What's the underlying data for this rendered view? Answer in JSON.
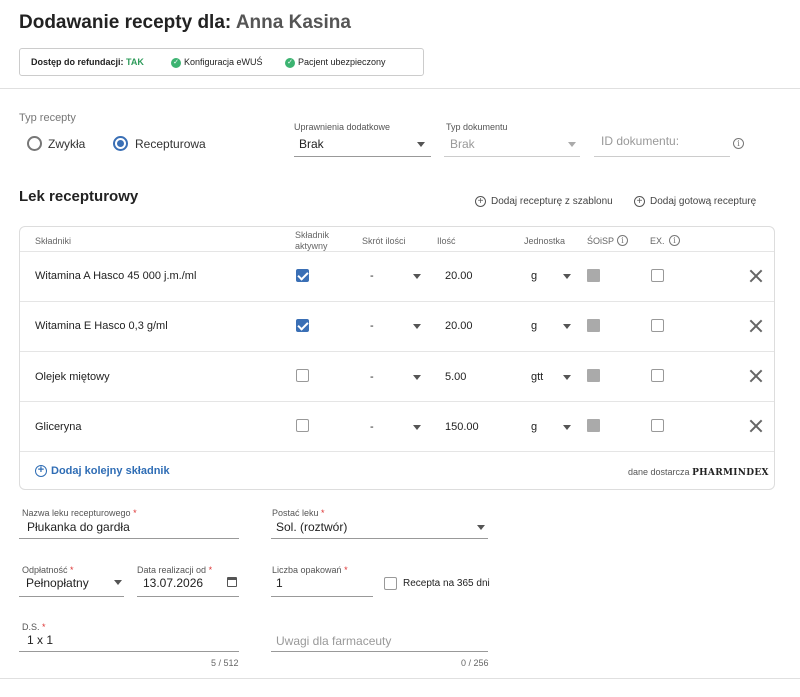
{
  "header": {
    "title_prefix": "Dodawanie recepty dla:",
    "patient_name": "Anna Kasina"
  },
  "status": {
    "refund_label": "Dostęp do refundacji:",
    "refund_value": "TAK",
    "ewus_label": "Konfiguracja eWUŚ",
    "insured_label": "Pacjent ubezpieczony"
  },
  "prescription_type": {
    "label": "Typ recepty",
    "options": [
      "Zwykła",
      "Recepturowa"
    ],
    "selected": "Recepturowa"
  },
  "permissions": {
    "label": "Uprawnienia dodatkowe",
    "value": "Brak"
  },
  "document_type": {
    "label": "Typ dokumentu",
    "value": "Brak"
  },
  "document_id": {
    "placeholder": "ID dokumentu:"
  },
  "section": {
    "title": "Lek recepturowy",
    "template_action": "Dodaj recepturę z szablonu",
    "ready_action": "Dodaj gotową recepturę"
  },
  "table": {
    "headers": {
      "ingredients": "Składniki",
      "active_line1": "Składnik",
      "active_line2": "aktywny",
      "abbrev": "Skrót ilości",
      "amount": "Ilość",
      "unit": "Jednostka",
      "soisp": "ŚOiSP",
      "ex": "EX."
    },
    "rows": [
      {
        "name": "Witamina A Hasco 45 000 j.m./ml",
        "active": true,
        "abbrev": "-",
        "amount": "20.00",
        "unit": "g"
      },
      {
        "name": "Witamina E Hasco 0,3 g/ml",
        "active": true,
        "abbrev": "-",
        "amount": "20.00",
        "unit": "g"
      },
      {
        "name": "Olejek miętowy",
        "active": false,
        "abbrev": "-",
        "amount": "5.00",
        "unit": "gtt"
      },
      {
        "name": "Gliceryna",
        "active": false,
        "abbrev": "-",
        "amount": "150.00",
        "unit": "g"
      }
    ],
    "add_ingredient": "Dodaj kolejny składnik",
    "supplier_prefix": "dane dostarcza",
    "supplier_brand": "PHARMINDEX"
  },
  "form": {
    "drug_name": {
      "label": "Nazwa leku recepturowego",
      "value": "Płukanka do gardła"
    },
    "drug_form": {
      "label": "Postać leku",
      "value": "Sol. (roztwór)"
    },
    "payment": {
      "label": "Odpłatność",
      "value": "Pełnopłatny"
    },
    "realization_date": {
      "label": "Data realizacji od",
      "value": "13.07.2026"
    },
    "packages": {
      "label": "Liczba opakowań",
      "value": "1"
    },
    "recipe_365": {
      "label": "Recepta na 365 dni"
    },
    "ds": {
      "label": "D.S.",
      "value": "1 x 1",
      "counter": "5 / 512"
    },
    "pharmacist_notes": {
      "placeholder": "Uwagi dla farmaceuty",
      "counter": "0 / 256"
    },
    "required_mark": "*"
  }
}
